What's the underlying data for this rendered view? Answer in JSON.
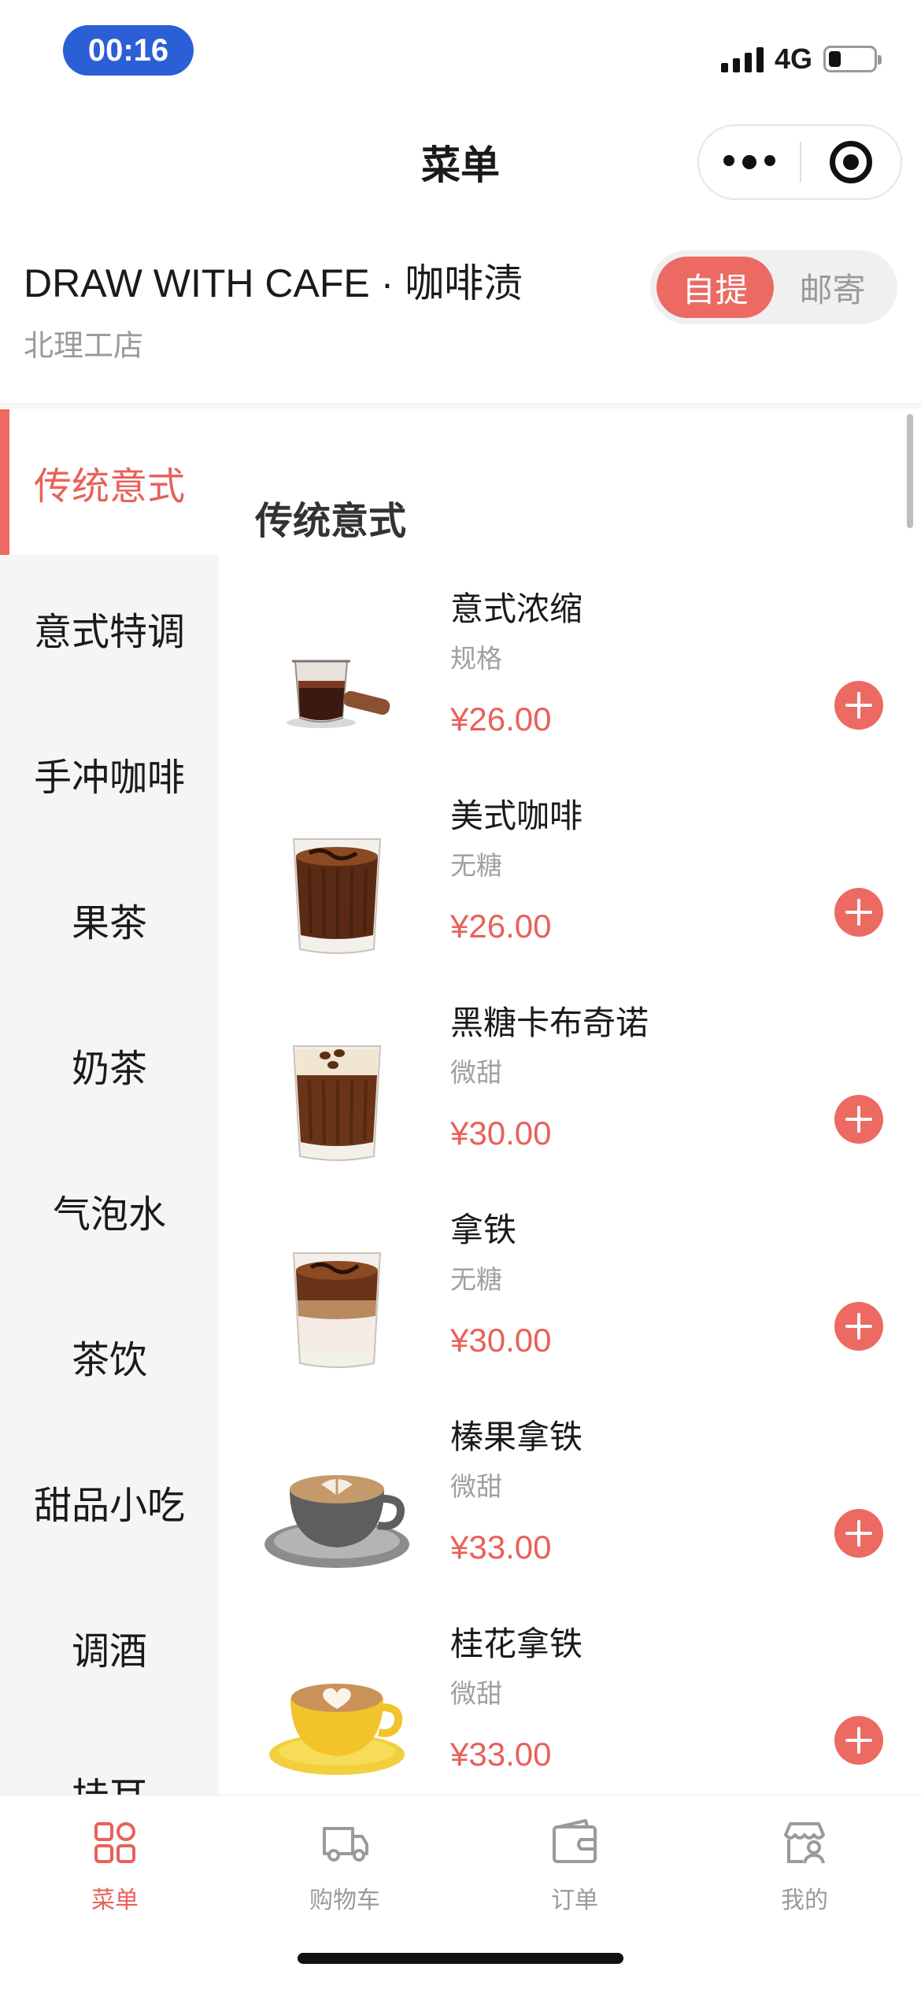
{
  "status_bar": {
    "time": "00:16",
    "network": "4G"
  },
  "nav": {
    "title": "菜单"
  },
  "shop": {
    "name": "DRAW WITH CAFE · 咖啡渍",
    "branch": "北理工店",
    "modes": [
      "自提",
      "邮寄"
    ],
    "active_mode": "自提"
  },
  "sidebar": {
    "categories": [
      "传统意式",
      "意式特调",
      "手冲咖啡",
      "果茶",
      "奶茶",
      "气泡水",
      "茶饮",
      "甜品小吃",
      "调酒",
      "挂耳"
    ],
    "active": "传统意式"
  },
  "section": {
    "title": "传统意式"
  },
  "products": [
    {
      "name": "意式浓缩",
      "spec": "规格",
      "price": "¥26.00",
      "image": "espresso-pitcher"
    },
    {
      "name": "美式咖啡",
      "spec": "无糖",
      "price": "¥26.00",
      "image": "americano-glass"
    },
    {
      "name": "黑糖卡布奇诺",
      "spec": "微甜",
      "price": "¥30.00",
      "image": "brown-sugar-cappuccino-glass"
    },
    {
      "name": "拿铁",
      "spec": "无糖",
      "price": "¥30.00",
      "image": "latte-glass"
    },
    {
      "name": "榛果拿铁",
      "spec": "微甜",
      "price": "¥33.00",
      "image": "hazelnut-latte-cup"
    },
    {
      "name": "桂花拿铁",
      "spec": "微甜",
      "price": "¥33.00",
      "image": "osmanthus-latte-cup"
    }
  ],
  "tab_bar": {
    "tabs": [
      {
        "label": "菜单",
        "icon": "menu-grid-icon"
      },
      {
        "label": "购物车",
        "icon": "truck-icon"
      },
      {
        "label": "订单",
        "icon": "wallet-icon"
      },
      {
        "label": "我的",
        "icon": "store-user-icon"
      }
    ],
    "active": "菜单"
  },
  "colors": {
    "accent": "#ec6a62",
    "price": "#e8615a",
    "time_pill": "#2a5fd6",
    "sidebar_bg": "#f5f5f5"
  }
}
